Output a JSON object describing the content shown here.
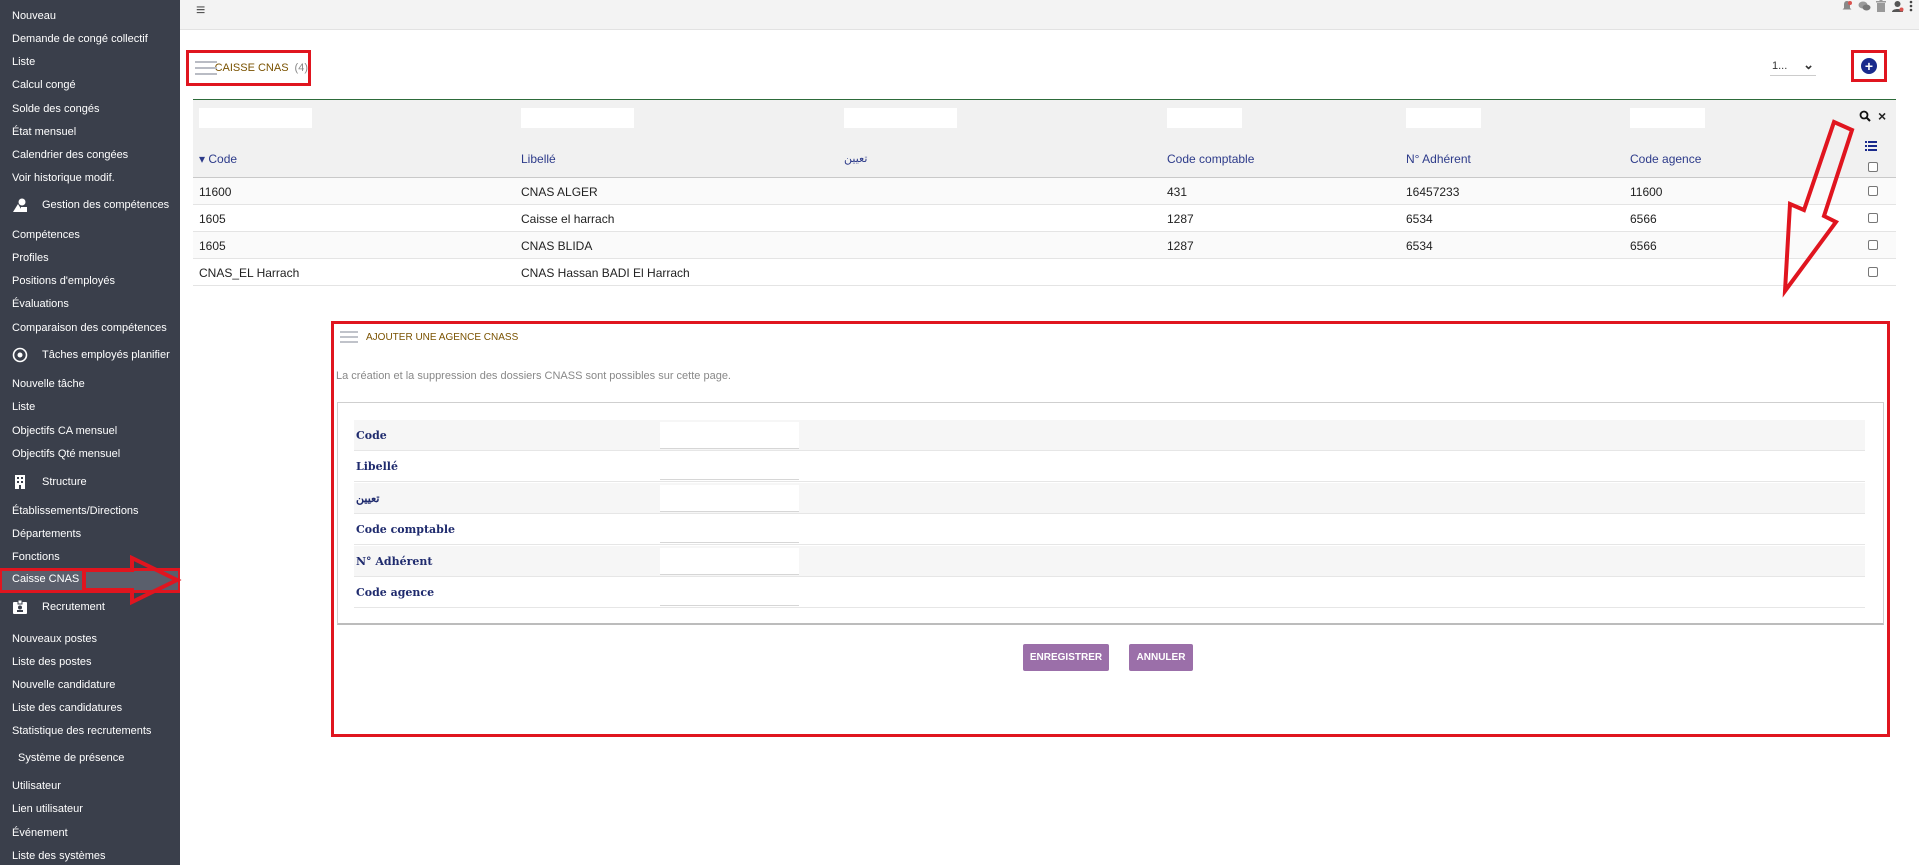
{
  "sidebar": {
    "items": [
      {
        "label": "Nouveau"
      },
      {
        "label": "Demande de congé collectif"
      },
      {
        "label": "Liste"
      },
      {
        "label": "Calcul congé"
      },
      {
        "label": "Solde des congés"
      },
      {
        "label": "État mensuel"
      },
      {
        "label": "Calendrier des congées"
      },
      {
        "label": "Voir historique modif."
      },
      {
        "label": "Gestion des compétences",
        "icon": "shapes-icon"
      },
      {
        "label": "Compétences"
      },
      {
        "label": "Profiles"
      },
      {
        "label": "Positions d'employés"
      },
      {
        "label": "Évaluations"
      },
      {
        "label": "Comparaison des compétences"
      },
      {
        "label": "Tâches employés planifier",
        "icon": "target-icon"
      },
      {
        "label": "Nouvelle tâche"
      },
      {
        "label": "Liste"
      },
      {
        "label": "Objectifs CA mensuel"
      },
      {
        "label": "Objectifs Qté mensuel"
      },
      {
        "label": "Structure",
        "icon": "building-icon"
      },
      {
        "label": "Établissements/Directions"
      },
      {
        "label": "Départements"
      },
      {
        "label": "Fonctions"
      },
      {
        "label": "Caisse CNAS",
        "active": true
      },
      {
        "label": "Recrutement",
        "icon": "badge-icon"
      },
      {
        "label": "Nouveaux postes"
      },
      {
        "label": "Liste des postes"
      },
      {
        "label": "Nouvelle candidature"
      },
      {
        "label": "Liste des candidatures"
      },
      {
        "label": "Statistique des recrutements"
      },
      {
        "label": "Système de présence"
      },
      {
        "label": "Utilisateur"
      },
      {
        "label": "Lien utilisateur"
      },
      {
        "label": "Événement"
      },
      {
        "label": "Liste des systèmes"
      }
    ]
  },
  "topbar": {
    "icons": [
      "bell-icon",
      "chat-icon",
      "trash-icon",
      "user-icon",
      "more-vertical-icon"
    ]
  },
  "list": {
    "title": "CAISSE CNAS",
    "count": "(4)",
    "pager_value": "1...",
    "columns": [
      "Code",
      "Libellé",
      "تعيين",
      "Code comptable",
      "N° Adhérent",
      "Code agence"
    ],
    "rows": [
      [
        "11600",
        "CNAS ALGER",
        "",
        "431",
        "16457233",
        "11600"
      ],
      [
        "1605",
        "Caisse el harrach",
        "",
        "1287",
        "6534",
        "6566"
      ],
      [
        "1605",
        "CNAS BLIDA",
        "",
        "1287",
        "6534",
        "6566"
      ],
      [
        "CNAS_EL Harrach",
        "CNAS Hassan BADI El Harrach",
        "",
        "",
        "",
        ""
      ]
    ]
  },
  "form": {
    "title": "AJOUTER UNE AGENCE CNASS",
    "description": "La création et la suppression des dossiers CNASS sont possibles sur cette page.",
    "fields": [
      {
        "label": "Code",
        "value": ""
      },
      {
        "label": "Libellé",
        "value": ""
      },
      {
        "label": "تعيين",
        "value": ""
      },
      {
        "label": "Code comptable",
        "value": ""
      },
      {
        "label": "N° Adhérent",
        "value": ""
      },
      {
        "label": "Code agence",
        "value": ""
      }
    ],
    "save_label": "ENREGISTRER",
    "cancel_label": "ANNULER"
  },
  "colors": {
    "sidebar_bg": "#3a3f4b",
    "highlight_red": "#e0151f",
    "header_text": "#2d3b8a",
    "button_purple": "#9b6fa9",
    "title_text": "#7a5200"
  }
}
